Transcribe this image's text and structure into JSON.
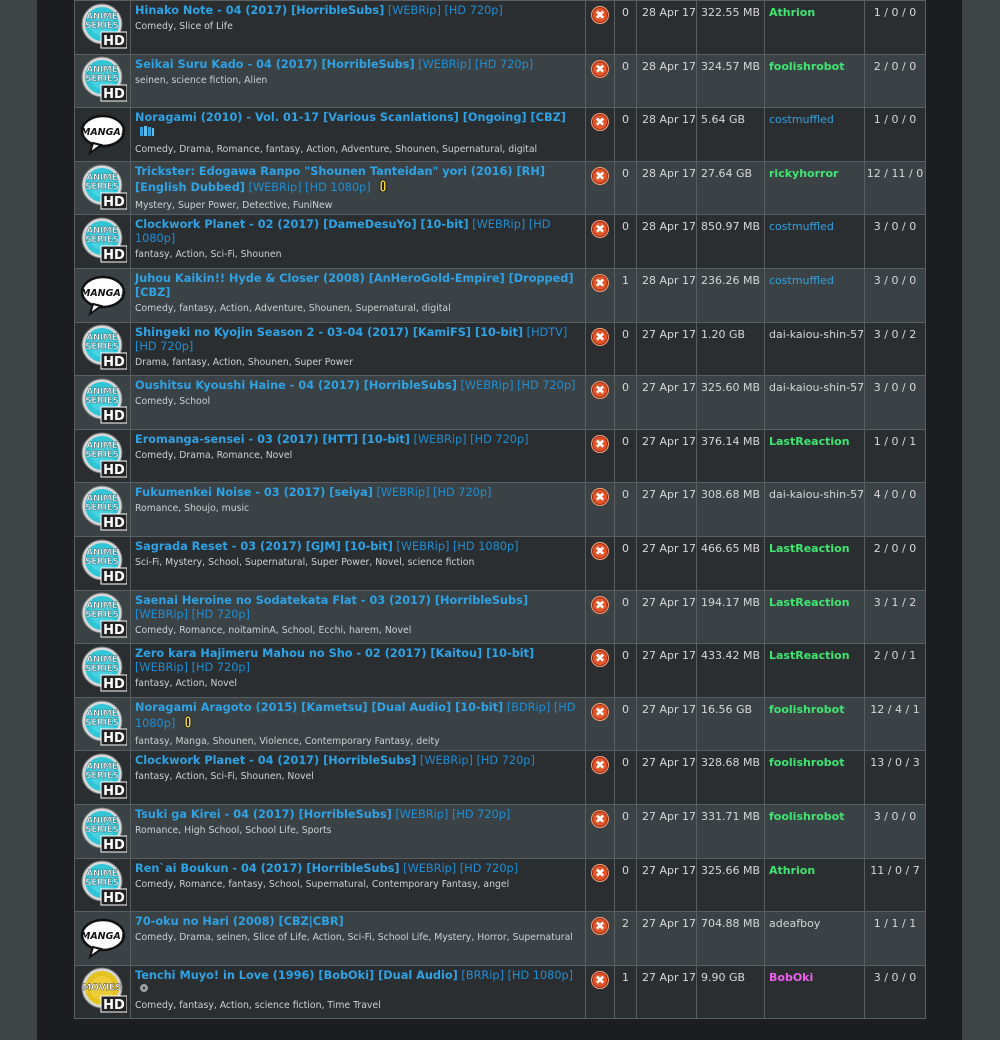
{
  "badge_text": {
    "anime_line1": "ANIME",
    "anime_line2": "SERIES",
    "hd": "HD",
    "manga": "MANGA!",
    "movies": "MOVIES"
  },
  "colors": {
    "link": "#2ea3e6",
    "uploader_green": "#3ee86e",
    "uploader_pink": "#f060f0",
    "delete": "#e8542a"
  },
  "rows": [
    {
      "category": "anime-series-hd",
      "title": "Hinako Note - 04 (2017) [HorribleSubs]",
      "tags": "[WEBRip] [HD 720p]",
      "extra": "",
      "genres": "Comedy, Slice of Life",
      "comments": "0",
      "date": "28 Apr 17",
      "size": "322.55 MB",
      "uploader": "Athrion",
      "uploader_style": "green",
      "stats": "1 / 0 / 0"
    },
    {
      "category": "anime-series-hd",
      "title": "Seikai Suru Kado - 04 (2017) [HorribleSubs]",
      "tags": "[WEBRip] [HD 720p]",
      "extra": "",
      "genres": "seinen, science fiction, Alien",
      "comments": "0",
      "date": "28 Apr 17",
      "size": "324.57 MB",
      "uploader": "foolishrobot",
      "uploader_style": "green",
      "stats": "2 / 0 / 0"
    },
    {
      "category": "manga",
      "title": "Noragami (2010) - Vol. 01-17 [Various Scanlations] [Ongoing] [CBZ]",
      "tags": "",
      "extra": "stack",
      "genres": "Comedy, Drama, Romance, fantasy, Action, Adventure, Shounen, Supernatural, digital",
      "comments": "0",
      "date": "28 Apr 17",
      "size": "5.64 GB",
      "uploader": "costmuffled",
      "uploader_style": "link",
      "stats": "1 / 0 / 0"
    },
    {
      "category": "anime-series-hd",
      "title": "Trickster: Edogawa Ranpo \"Shounen Tanteidan\" yori (2016) [RH] [English Dubbed]",
      "tags": "[WEBRip] [HD 1080p]",
      "extra": "mic",
      "genres": "Mystery, Super Power, Detective, FuniNew",
      "comments": "0",
      "date": "28 Apr 17",
      "size": "27.64 GB",
      "uploader": "rickyhorror",
      "uploader_style": "green",
      "stats": "12 / 11 / 0"
    },
    {
      "category": "anime-series-hd",
      "title": "Clockwork Planet - 02 (2017) [DameDesuYo] [10-bit]",
      "tags": "[WEBRip] [HD 1080p]",
      "extra": "",
      "genres": "fantasy, Action, Sci-Fi, Shounen",
      "comments": "0",
      "date": "28 Apr 17",
      "size": "850.97 MB",
      "uploader": "costmuffled",
      "uploader_style": "link",
      "stats": "3 / 0 / 0"
    },
    {
      "category": "manga",
      "title": "Juhou Kaikin!! Hyde & Closer (2008) [AnHeroGold-Empire] [Dropped] [CBZ]",
      "tags": "",
      "extra": "",
      "genres": "Comedy, fantasy, Action, Adventure, Shounen, Supernatural, digital",
      "comments": "1",
      "date": "28 Apr 17",
      "size": "236.26 MB",
      "uploader": "costmuffled",
      "uploader_style": "link",
      "stats": "3 / 0 / 0"
    },
    {
      "category": "anime-series-hd",
      "title": "Shingeki no Kyojin Season 2 - 03-04 (2017) [KamiFS] [10-bit]",
      "tags": "[HDTV] [HD 720p]",
      "extra": "",
      "genres": "Drama, fantasy, Action, Shounen, Super Power",
      "comments": "0",
      "date": "27 Apr 17",
      "size": "1.20 GB",
      "uploader": "dai-kaiou-shin-57",
      "uploader_style": "plain",
      "stats": "3 / 0 / 2"
    },
    {
      "category": "anime-series-hd",
      "title": "Oushitsu Kyoushi Haine - 04 (2017) [HorribleSubs]",
      "tags": "[WEBRip] [HD 720p]",
      "extra": "",
      "genres": "Comedy, School",
      "comments": "0",
      "date": "27 Apr 17",
      "size": "325.60 MB",
      "uploader": "dai-kaiou-shin-57",
      "uploader_style": "plain",
      "stats": "3 / 0 / 0"
    },
    {
      "category": "anime-series-hd",
      "title": "Eromanga-sensei - 03 (2017) [HTT] [10-bit]",
      "tags": "[WEBRip] [HD 720p]",
      "extra": "",
      "genres": "Comedy, Drama, Romance, Novel",
      "comments": "0",
      "date": "27 Apr 17",
      "size": "376.14 MB",
      "uploader": "LastReaction",
      "uploader_style": "green",
      "stats": "1 / 0 / 1"
    },
    {
      "category": "anime-series-hd",
      "title": "Fukumenkei Noise - 03 (2017) [seiya]",
      "tags": "[WEBRip] [HD 720p]",
      "extra": "",
      "genres": "Romance, Shoujo, music",
      "comments": "0",
      "date": "27 Apr 17",
      "size": "308.68 MB",
      "uploader": "dai-kaiou-shin-57",
      "uploader_style": "plain",
      "stats": "4 / 0 / 0"
    },
    {
      "category": "anime-series-hd",
      "title": "Sagrada Reset - 03 (2017) [GJM] [10-bit]",
      "tags": "[WEBRip] [HD 1080p]",
      "extra": "",
      "genres": "Sci-Fi, Mystery, School, Supernatural, Super Power, Novel, science fiction",
      "comments": "0",
      "date": "27 Apr 17",
      "size": "466.65 MB",
      "uploader": "LastReaction",
      "uploader_style": "green",
      "stats": "2 / 0 / 0"
    },
    {
      "category": "anime-series-hd",
      "title": "Saenai Heroine no Sodatekata Flat - 03 (2017) [HorribleSubs]",
      "tags": "[WEBRip] [HD 720p]",
      "extra": "",
      "genres": "Comedy, Romance, noitaminA, School, Ecchi, harem, Novel",
      "comments": "0",
      "date": "27 Apr 17",
      "size": "194.17 MB",
      "uploader": "LastReaction",
      "uploader_style": "green",
      "stats": "3 / 1 / 2"
    },
    {
      "category": "anime-series-hd",
      "title": "Zero kara Hajimeru Mahou no Sho - 02 (2017) [Kaitou] [10-bit]",
      "tags": "[WEBRip] [HD 720p]",
      "extra": "",
      "genres": "fantasy, Action, Novel",
      "comments": "0",
      "date": "27 Apr 17",
      "size": "433.42 MB",
      "uploader": "LastReaction",
      "uploader_style": "green",
      "stats": "2 / 0 / 1"
    },
    {
      "category": "anime-series-hd",
      "title": "Noragami Aragoto (2015) [Kametsu] [Dual Audio] [10-bit]",
      "tags": "[BDRip] [HD 1080p]",
      "extra": "mic",
      "genres": "fantasy, Manga, Shounen, Violence, Contemporary Fantasy, deity",
      "comments": "0",
      "date": "27 Apr 17",
      "size": "16.56 GB",
      "uploader": "foolishrobot",
      "uploader_style": "green",
      "stats": "12 / 4 / 1"
    },
    {
      "category": "anime-series-hd",
      "title": "Clockwork Planet - 04 (2017) [HorribleSubs]",
      "tags": "[WEBRip] [HD 720p]",
      "extra": "",
      "genres": "fantasy, Action, Sci-Fi, Shounen, Novel",
      "comments": "0",
      "date": "27 Apr 17",
      "size": "328.68 MB",
      "uploader": "foolishrobot",
      "uploader_style": "green",
      "stats": "13 / 0 / 3"
    },
    {
      "category": "anime-series-hd",
      "title": "Tsuki ga Kirei - 04 (2017) [HorribleSubs]",
      "tags": "[WEBRip] [HD 720p]",
      "extra": "",
      "genres": "Romance, High School, School Life, Sports",
      "comments": "0",
      "date": "27 Apr 17",
      "size": "331.71 MB",
      "uploader": "foolishrobot",
      "uploader_style": "green",
      "stats": "3 / 0 / 0"
    },
    {
      "category": "anime-series-hd",
      "title": "Ren`ai Boukun - 04 (2017) [HorribleSubs]",
      "tags": "[WEBRip] [HD 720p]",
      "extra": "",
      "genres": "Comedy, Romance, fantasy, School, Supernatural, Contemporary Fantasy, angel",
      "comments": "0",
      "date": "27 Apr 17",
      "size": "325.66 MB",
      "uploader": "Athrion",
      "uploader_style": "green",
      "stats": "11 / 0 / 7"
    },
    {
      "category": "manga",
      "title": "70-oku no Hari (2008) [CBZ|CBR]",
      "tags": "",
      "extra": "",
      "genres": "Comedy, Drama, seinen, Slice of Life, Action, Sci-Fi, School Life, Mystery, Horror, Supernatural",
      "comments": "2",
      "date": "27 Apr 17",
      "size": "704.88 MB",
      "uploader": "adeafboy",
      "uploader_style": "plain",
      "stats": "1 / 1 / 1"
    },
    {
      "category": "movies-hd",
      "title": "Tenchi Muyo! in Love (1996) [BobOki] [Dual Audio]",
      "tags": "[BRRip] [HD 1080p]",
      "extra": "disc",
      "genres": "Comedy, fantasy, Action, science fiction, Time Travel",
      "comments": "1",
      "date": "27 Apr 17",
      "size": "9.90 GB",
      "uploader": "BobOki",
      "uploader_style": "pink",
      "stats": "3 / 0 / 0"
    }
  ]
}
